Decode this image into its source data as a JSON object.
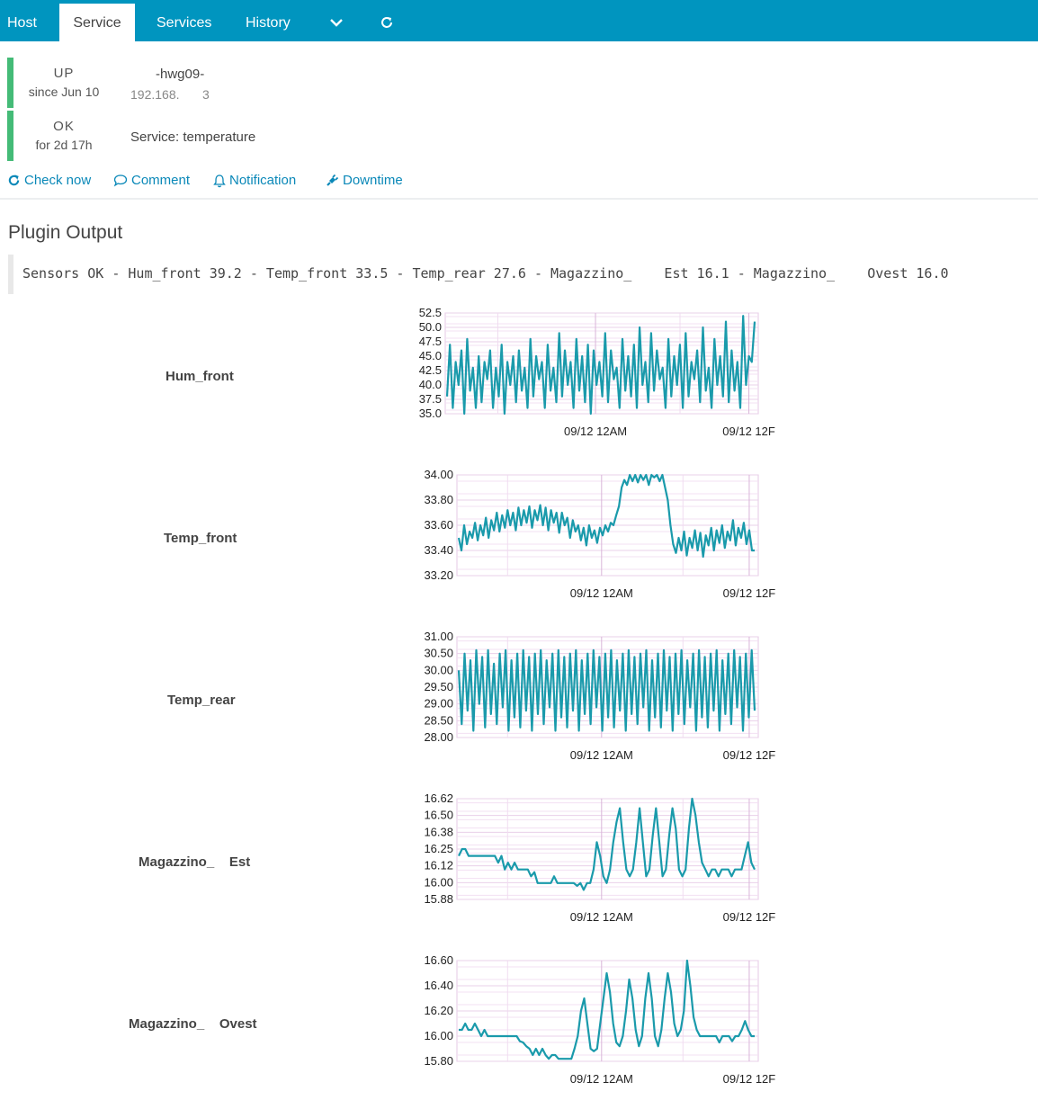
{
  "tabs": [
    {
      "label": "Host",
      "active": false
    },
    {
      "label": "Service",
      "active": true
    },
    {
      "label": "Services",
      "active": false
    },
    {
      "label": "History",
      "active": false
    }
  ],
  "tab_icons": [
    "chevron-down-icon",
    "refresh-icon"
  ],
  "host": {
    "state": "UP",
    "since": "since Jun 10",
    "name": "-hwg09-",
    "address": "192.168.",
    "address_suffix": "3",
    "state_color": "#44bb77"
  },
  "service": {
    "state": "OK",
    "since": "for 2d 17h",
    "name": "Service: temperature",
    "state_color": "#44bb77"
  },
  "actions": [
    {
      "label": "Check now",
      "icon": "refresh-icon"
    },
    {
      "label": "Comment",
      "icon": "comment-icon"
    },
    {
      "label": "Notification",
      "icon": "bell-icon"
    },
    {
      "label": "Downtime",
      "icon": "plug-icon"
    }
  ],
  "plugin_output": {
    "title": "Plugin Output",
    "text": "Sensors OK - Hum_front 39.2 - Temp_front 33.5 - Temp_rear 27.6 - Magazzino_    Est 16.1 - Magazzino_    Ovest 16.0"
  },
  "colors": {
    "accent": "#0095bf",
    "link": "#0a88b8",
    "line": "#1a9aab",
    "ok": "#44bb77"
  },
  "chart_data": [
    {
      "type": "line",
      "label": "Hum_front",
      "yticks": [
        "52.5",
        "50.0",
        "47.5",
        "45.0",
        "42.5",
        "40.0",
        "37.5",
        "35.0"
      ],
      "ylim": [
        35.0,
        52.5
      ],
      "xticks": [
        "09/12 12AM",
        "09/12 12F"
      ],
      "grid": true,
      "series": [
        {
          "values": [
            38,
            47,
            36,
            44,
            40,
            46,
            35,
            48,
            39,
            43,
            36,
            45,
            37,
            44,
            41,
            46,
            36,
            43,
            38,
            47,
            35,
            44,
            40,
            45,
            37,
            46,
            39,
            43,
            36,
            48,
            38,
            45,
            41,
            44,
            36,
            47,
            39,
            43,
            37,
            49,
            38,
            46,
            40,
            44,
            36,
            48,
            39,
            45,
            37,
            47,
            35,
            46,
            40,
            44,
            38,
            49,
            37,
            46,
            41,
            43,
            36,
            48,
            39,
            45,
            38,
            47,
            36,
            50,
            40,
            44,
            37,
            49,
            39,
            46,
            41,
            43,
            36,
            48,
            38,
            45,
            40,
            47,
            36,
            49,
            38,
            44,
            41,
            46,
            37,
            50,
            39,
            43,
            36,
            48,
            40,
            45,
            38,
            51,
            37,
            46,
            39,
            44,
            36,
            52,
            40,
            45,
            44,
            51
          ]
        }
      ]
    },
    {
      "type": "line",
      "label": "Temp_front",
      "yticks": [
        "34.00",
        "33.80",
        "33.60",
        "33.40",
        "33.20"
      ],
      "ylim": [
        33.2,
        34.0
      ],
      "xticks": [
        "09/12 12AM",
        "09/12 12F"
      ],
      "grid": true,
      "series": [
        {
          "values": [
            33.5,
            33.4,
            33.6,
            33.45,
            33.55,
            33.5,
            33.62,
            33.48,
            33.6,
            33.52,
            33.66,
            33.5,
            33.64,
            33.56,
            33.7,
            33.55,
            33.68,
            33.58,
            33.72,
            33.6,
            33.7,
            33.56,
            33.74,
            33.6,
            33.72,
            33.62,
            33.75,
            33.58,
            33.72,
            33.64,
            33.76,
            33.6,
            33.74,
            33.56,
            33.72,
            33.62,
            33.7,
            33.54,
            33.7,
            33.6,
            33.66,
            33.5,
            33.64,
            33.55,
            33.6,
            33.48,
            33.58,
            33.44,
            33.6,
            33.5,
            33.56,
            33.46,
            33.58,
            33.52,
            33.6,
            33.55,
            33.62,
            33.6,
            33.68,
            33.75,
            33.9,
            33.96,
            33.92,
            34.0,
            33.95,
            34.0,
            33.94,
            34.0,
            33.96,
            34.0,
            33.92,
            34.0,
            33.98,
            34.0,
            33.95,
            34.0,
            33.9,
            33.8,
            33.6,
            33.45,
            33.38,
            33.5,
            33.4,
            33.55,
            33.36,
            33.5,
            33.42,
            33.56,
            33.4,
            33.54,
            33.35,
            33.52,
            33.44,
            33.58,
            33.4,
            33.56,
            33.46,
            33.6,
            33.42,
            33.55,
            33.48,
            33.64,
            33.44,
            33.58,
            33.5,
            33.62,
            33.45,
            33.56,
            33.4,
            33.4
          ]
        }
      ]
    },
    {
      "type": "line",
      "label": "Temp_rear",
      "yticks": [
        "31.00",
        "30.50",
        "30.00",
        "29.50",
        "29.00",
        "28.50",
        "28.00"
      ],
      "ylim": [
        28.0,
        31.0
      ],
      "xticks": [
        "09/12 12AM",
        "09/12 12F"
      ],
      "grid": true,
      "series": [
        {
          "values": [
            30.0,
            28.4,
            30.5,
            28.8,
            30.3,
            28.2,
            30.6,
            29.0,
            30.4,
            28.3,
            30.6,
            28.7,
            30.2,
            28.4,
            30.5,
            28.9,
            30.6,
            28.2,
            30.3,
            28.6,
            30.5,
            28.3,
            30.6,
            28.8,
            30.4,
            28.2,
            30.5,
            28.7,
            30.6,
            28.4,
            30.3,
            28.9,
            30.5,
            28.2,
            30.6,
            28.6,
            30.4,
            28.3,
            30.5,
            28.8,
            30.6,
            28.2,
            30.3,
            28.7,
            30.5,
            28.4,
            30.6,
            28.9,
            30.4,
            28.2,
            30.5,
            28.6,
            30.6,
            28.3,
            30.3,
            28.8,
            30.5,
            28.2,
            30.6,
            28.7,
            30.4,
            28.4,
            30.5,
            28.9,
            30.6,
            28.2,
            30.3,
            28.6,
            30.5,
            28.3,
            30.6,
            28.8,
            30.4,
            28.2,
            30.5,
            28.7,
            30.6,
            28.4,
            30.3,
            28.9,
            30.5,
            28.2,
            30.6,
            28.6,
            30.4,
            28.3,
            30.5,
            28.8,
            30.6,
            28.2,
            30.3,
            28.7,
            30.5,
            28.4,
            30.6,
            28.9,
            30.4,
            28.2,
            30.5,
            28.6,
            30.6,
            28.8
          ]
        }
      ]
    },
    {
      "type": "line",
      "label": "Magazzino_    Est",
      "yticks": [
        "16.62",
        "16.50",
        "16.38",
        "16.25",
        "16.12",
        "16.00",
        "15.88"
      ],
      "ylim": [
        15.88,
        16.62
      ],
      "xticks": [
        "09/12 12AM",
        "09/12 12F"
      ],
      "grid": true,
      "series": [
        {
          "values": [
            16.2,
            16.25,
            16.25,
            16.2,
            16.2,
            16.2,
            16.2,
            16.2,
            16.2,
            16.2,
            16.2,
            16.2,
            16.15,
            16.2,
            16.1,
            16.15,
            16.1,
            16.15,
            16.1,
            16.1,
            16.1,
            16.1,
            16.05,
            16.08,
            16.0,
            16.0,
            16.0,
            16.0,
            16.0,
            16.05,
            16.0,
            16.0,
            16.0,
            16.0,
            16.0,
            16.0,
            15.98,
            16.0,
            15.95,
            16.0,
            16.0,
            16.1,
            16.3,
            16.2,
            16.05,
            16.0,
            16.1,
            16.3,
            16.45,
            16.55,
            16.3,
            16.1,
            16.05,
            16.1,
            16.3,
            16.55,
            16.3,
            16.05,
            16.1,
            16.35,
            16.55,
            16.3,
            16.05,
            16.1,
            16.35,
            16.55,
            16.4,
            16.1,
            16.05,
            16.1,
            16.4,
            16.62,
            16.5,
            16.3,
            16.15,
            16.1,
            16.05,
            16.1,
            16.1,
            16.05,
            16.1,
            16.1,
            16.1,
            16.05,
            16.1,
            16.1,
            16.1,
            16.2,
            16.3,
            16.15,
            16.1
          ]
        }
      ]
    },
    {
      "type": "line",
      "label": "Magazzino_    Ovest",
      "yticks": [
        "16.60",
        "16.40",
        "16.20",
        "16.00",
        "15.80"
      ],
      "ylim": [
        15.8,
        16.6
      ],
      "xticks": [
        "09/12 12AM",
        "09/12 12F"
      ],
      "grid": true,
      "series": [
        {
          "values": [
            16.05,
            16.05,
            16.1,
            16.05,
            16.05,
            16.1,
            16.05,
            16.0,
            16.05,
            16.0,
            16.0,
            16.0,
            16.0,
            16.0,
            16.0,
            16.0,
            16.0,
            16.0,
            16.0,
            15.96,
            15.95,
            15.92,
            15.9,
            15.85,
            15.9,
            15.85,
            15.9,
            15.85,
            15.82,
            15.85,
            15.85,
            15.82,
            15.82,
            15.82,
            15.82,
            15.82,
            15.9,
            16.0,
            16.2,
            16.3,
            16.1,
            15.9,
            15.88,
            15.9,
            16.1,
            16.3,
            16.5,
            16.35,
            16.1,
            15.95,
            15.92,
            16.0,
            16.2,
            16.45,
            16.3,
            16.05,
            15.92,
            16.0,
            16.3,
            16.5,
            16.3,
            16.0,
            15.92,
            16.05,
            16.3,
            16.5,
            16.35,
            16.1,
            16.0,
            16.05,
            16.2,
            16.6,
            16.4,
            16.15,
            16.05,
            16.0,
            16.0,
            16.0,
            16.0,
            16.0,
            16.0,
            15.95,
            16.0,
            16.0,
            16.0,
            15.96,
            16.0,
            16.0,
            16.05,
            16.12,
            16.05,
            16.0,
            16.0
          ]
        }
      ]
    }
  ]
}
